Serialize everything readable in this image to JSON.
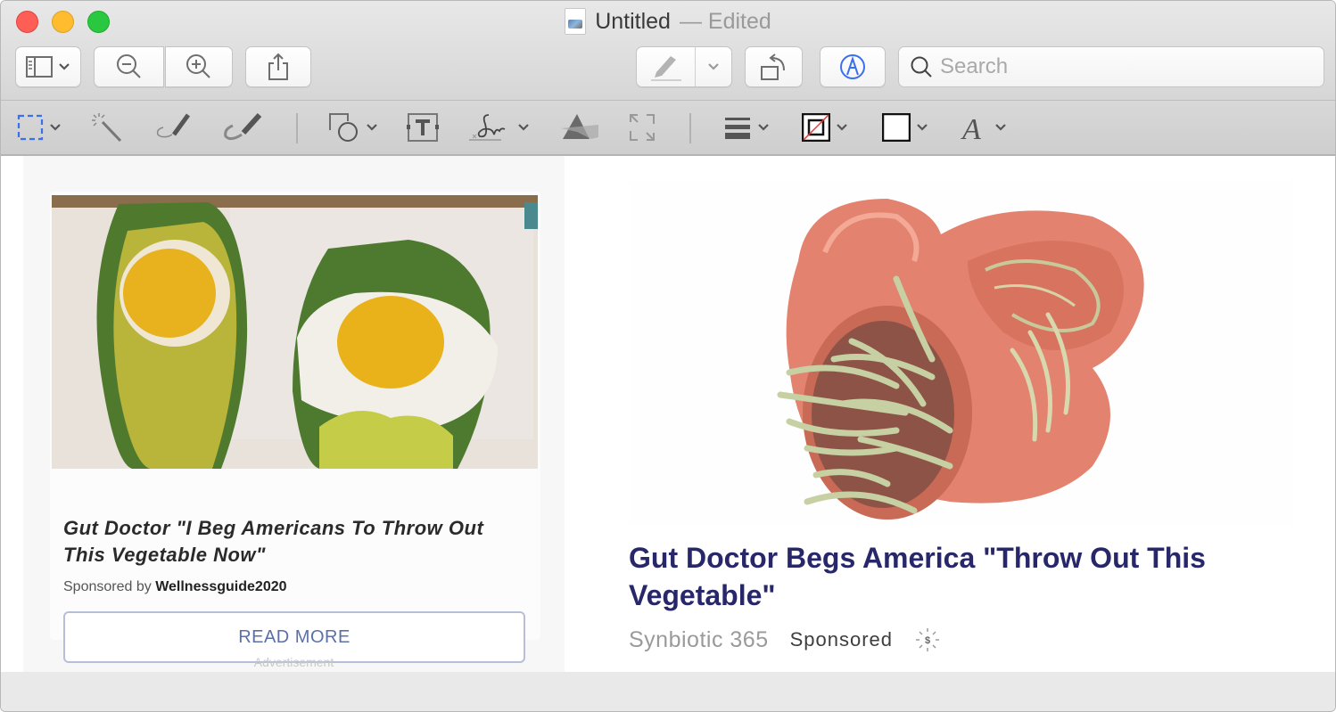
{
  "window": {
    "title": "Untitled",
    "title_suffix": "— Edited"
  },
  "toolbar": {
    "sidebar_button": "sidebar-toggle",
    "zoom_out": "zoom-out",
    "zoom_in": "zoom-in",
    "share": "share",
    "highlight": "highlight",
    "rotate": "rotate",
    "markup": "markup",
    "search_placeholder": "Search",
    "search_value": ""
  },
  "markup_tools": [
    {
      "name": "rectangular-selection",
      "has_menu": true
    },
    {
      "name": "instant-alpha",
      "has_menu": false
    },
    {
      "name": "sketch",
      "has_menu": false
    },
    {
      "name": "draw",
      "has_menu": false
    },
    {
      "name": "shapes",
      "has_menu": true
    },
    {
      "name": "text",
      "has_menu": false
    },
    {
      "name": "sign",
      "has_menu": true
    },
    {
      "name": "adjust-color",
      "has_menu": false
    },
    {
      "name": "adjust-size",
      "has_menu": false
    },
    {
      "name": "shape-style",
      "has_menu": true
    },
    {
      "name": "border-color",
      "has_menu": true
    },
    {
      "name": "fill-color",
      "has_menu": true
    },
    {
      "name": "text-style",
      "has_menu": true
    }
  ],
  "ads": [
    {
      "title": "Gut Doctor \"I Beg Americans To Throw Out This Vegetable Now\"",
      "sponsored_prefix": "Sponsored by",
      "sponsor": "Wellnessguide2020",
      "button": "READ MORE",
      "footer": "Advertisement",
      "image": "avocado-eggs-photo"
    },
    {
      "title": "Gut Doctor Begs America \"Throw Out This Vegetable\"",
      "brand": "Synbiotic 365",
      "label": "Sponsored",
      "image": "intestine-worms-illustration"
    }
  ],
  "colors": {
    "accent_blue": "#3a6ff0",
    "ad2_title": "#27276a",
    "readmore_text": "#5c70a8"
  }
}
